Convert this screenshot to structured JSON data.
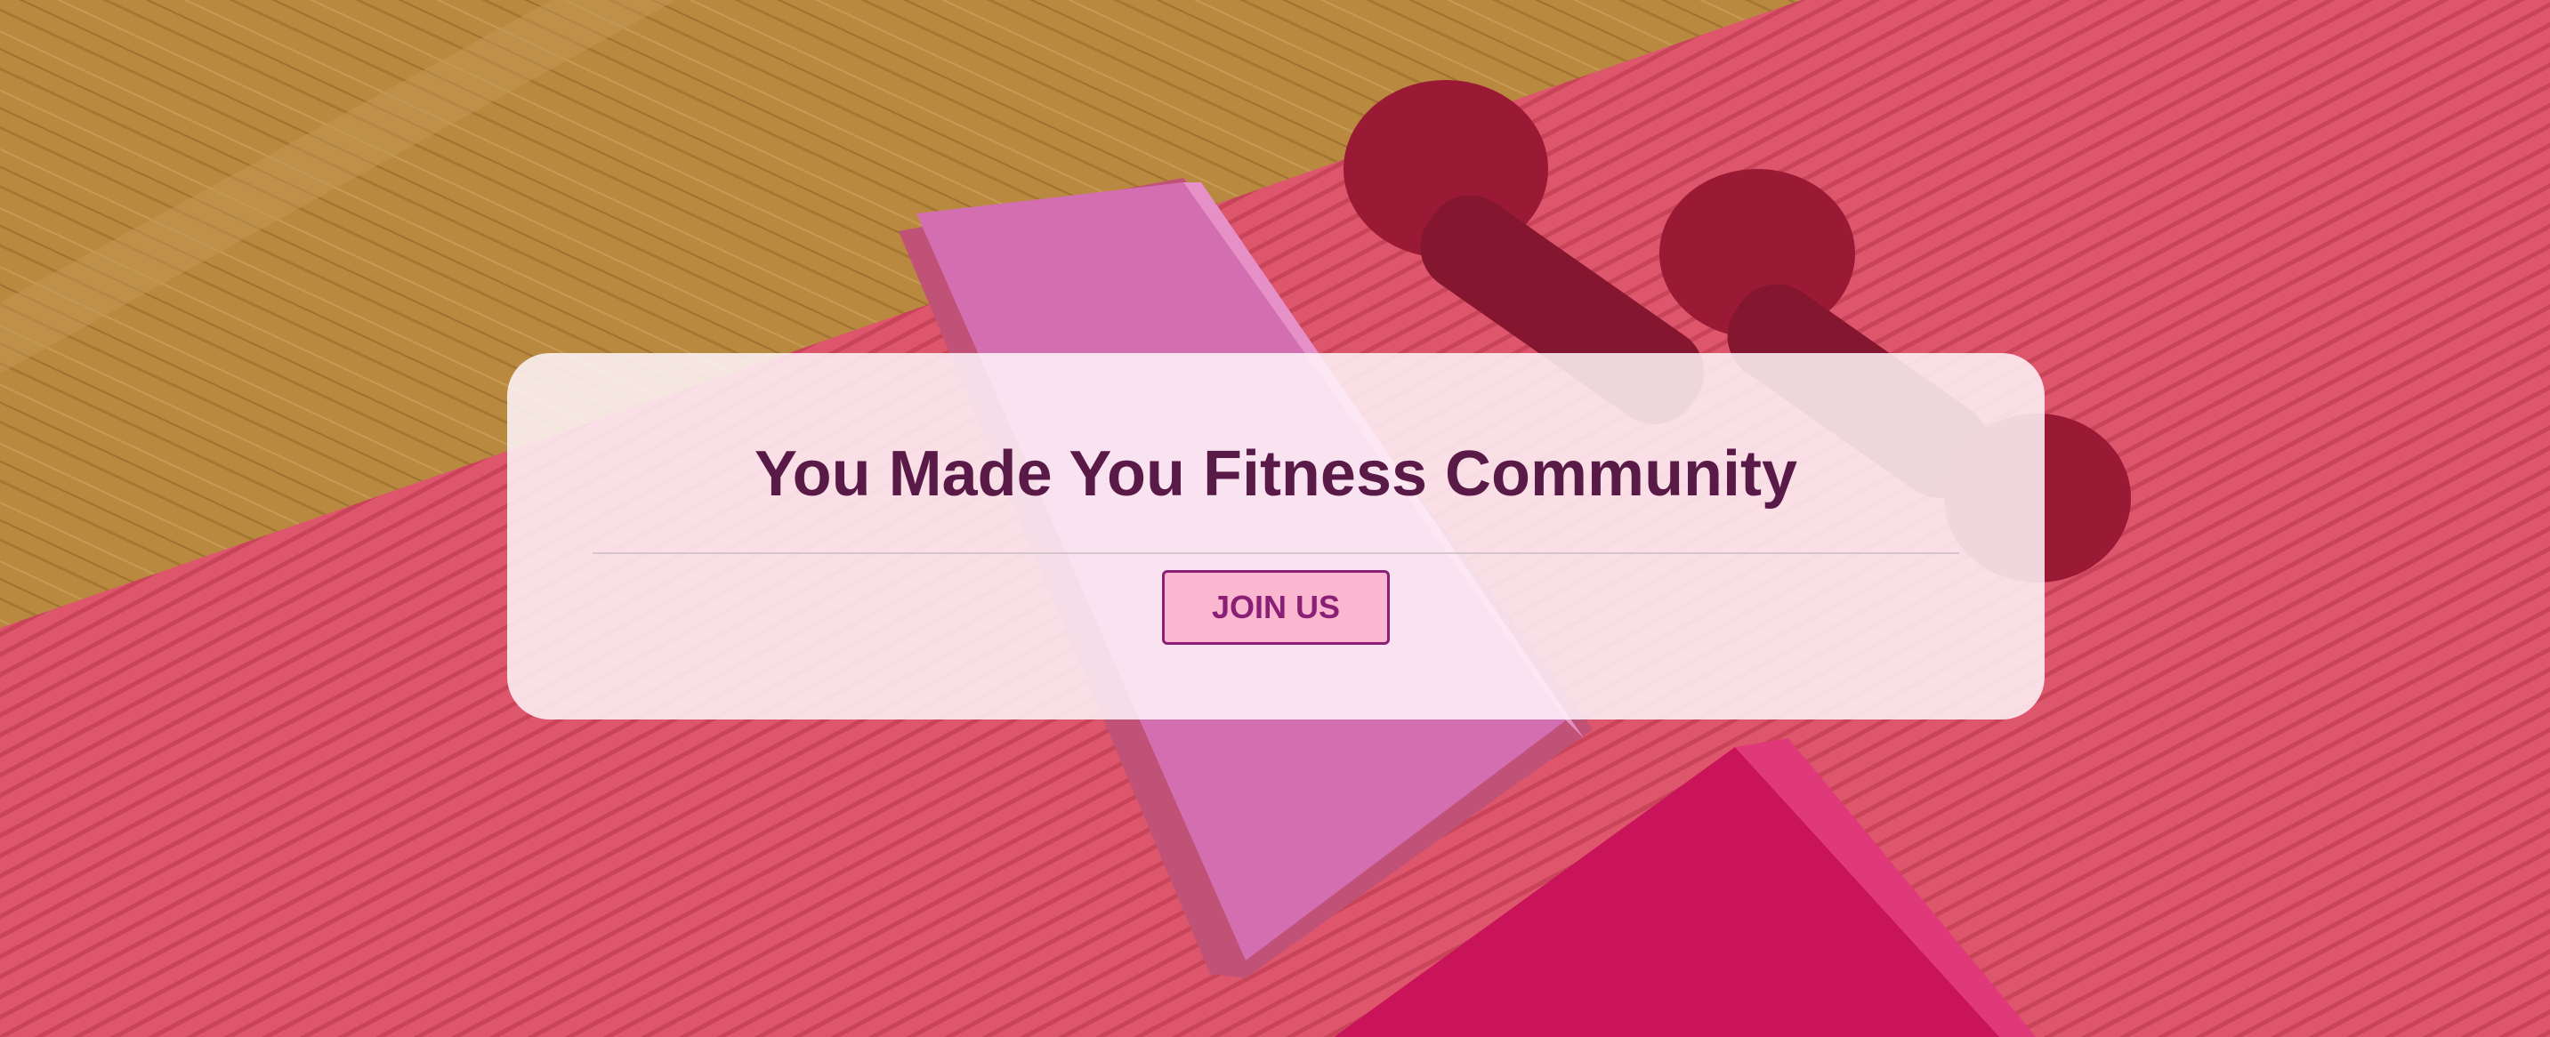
{
  "hero": {
    "title": "You Made You Fitness Community",
    "button_label": "JOIN US",
    "background_image": "fitness-mat-block-dumbbells"
  },
  "colors": {
    "floor": "#b9893f",
    "mat": "#dd566c",
    "block": "#d36fb0",
    "dumbbell": "#9a1a36",
    "towel": "#c9145a",
    "card": "#fff6fa",
    "title": "#5a1a47",
    "button_bg": "#fbb7cf",
    "button_text": "#8a1f76"
  }
}
